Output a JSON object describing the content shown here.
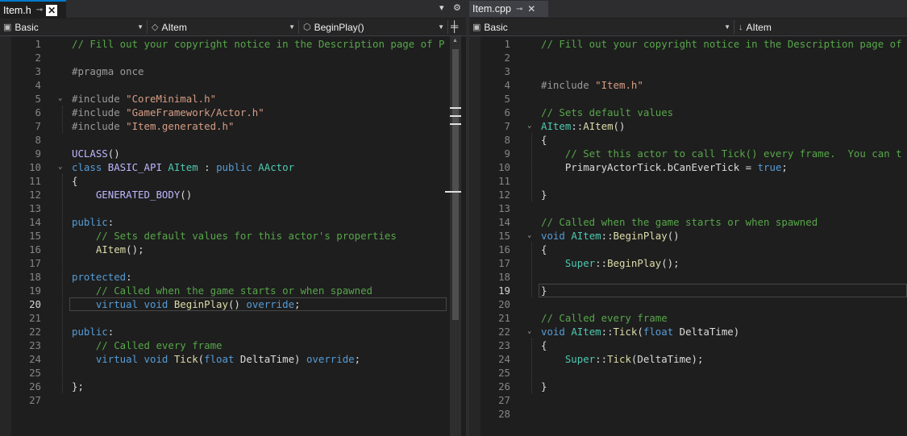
{
  "left": {
    "tab": {
      "name": "Item.h"
    },
    "nav": {
      "project": "Basic",
      "scope": "AItem",
      "member": "BeginPlay()"
    },
    "current_line": 20,
    "lines": [
      {
        "n": "1",
        "t": [
          {
            "c": "t-comment",
            "s": "// Fill out your copyright notice in the Description page of P"
          }
        ]
      },
      {
        "n": "2",
        "t": []
      },
      {
        "n": "3",
        "t": [
          {
            "c": "t-pre",
            "s": "#pragma once"
          }
        ]
      },
      {
        "n": "4",
        "t": []
      },
      {
        "n": "5",
        "fold": true,
        "t": [
          {
            "c": "t-pre",
            "s": "#include "
          },
          {
            "c": "t-str",
            "s": "\"CoreMinimal.h\""
          }
        ]
      },
      {
        "n": "6",
        "t": [
          {
            "c": "t-pre",
            "s": "#include "
          },
          {
            "c": "t-str",
            "s": "\"GameFramework/Actor.h\""
          }
        ]
      },
      {
        "n": "7",
        "t": [
          {
            "c": "t-pre",
            "s": "#include "
          },
          {
            "c": "t-str",
            "s": "\"Item.generated.h\""
          }
        ]
      },
      {
        "n": "8",
        "t": []
      },
      {
        "n": "9",
        "t": [
          {
            "c": "t-macro",
            "s": "UCLASS"
          },
          {
            "c": "t-plain",
            "s": "()"
          }
        ]
      },
      {
        "n": "10",
        "fold": true,
        "t": [
          {
            "c": "t-kw",
            "s": "class "
          },
          {
            "c": "t-macro",
            "s": "BASIC_API "
          },
          {
            "c": "t-type",
            "s": "AItem"
          },
          {
            "c": "t-plain",
            "s": " : "
          },
          {
            "c": "t-kw",
            "s": "public "
          },
          {
            "c": "t-type",
            "s": "AActor"
          }
        ]
      },
      {
        "n": "11",
        "t": [
          {
            "c": "t-plain",
            "s": "{"
          }
        ]
      },
      {
        "n": "12",
        "t": [
          {
            "c": "t-plain",
            "s": "    "
          },
          {
            "c": "t-macro",
            "s": "GENERATED_BODY"
          },
          {
            "c": "t-plain",
            "s": "()"
          }
        ]
      },
      {
        "n": "13",
        "t": []
      },
      {
        "n": "14",
        "t": [
          {
            "c": "t-kw",
            "s": "public"
          },
          {
            "c": "t-plain",
            "s": ":"
          }
        ]
      },
      {
        "n": "15",
        "t": [
          {
            "c": "t-plain",
            "s": "    "
          },
          {
            "c": "t-comment",
            "s": "// Sets default values for this actor's properties"
          }
        ]
      },
      {
        "n": "16",
        "t": [
          {
            "c": "t-plain",
            "s": "    "
          },
          {
            "c": "t-fn",
            "s": "AItem"
          },
          {
            "c": "t-plain",
            "s": "();"
          }
        ]
      },
      {
        "n": "17",
        "t": []
      },
      {
        "n": "18",
        "t": [
          {
            "c": "t-kw",
            "s": "protected"
          },
          {
            "c": "t-plain",
            "s": ":"
          }
        ]
      },
      {
        "n": "19",
        "t": [
          {
            "c": "t-plain",
            "s": "    "
          },
          {
            "c": "t-comment",
            "s": "// Called when the game starts or when spawned"
          }
        ]
      },
      {
        "n": "20",
        "t": [
          {
            "c": "t-plain",
            "s": "    "
          },
          {
            "c": "t-kw",
            "s": "virtual void "
          },
          {
            "c": "t-fn",
            "s": "BeginPlay"
          },
          {
            "c": "t-plain",
            "s": "() "
          },
          {
            "c": "t-kw",
            "s": "override"
          },
          {
            "c": "t-plain",
            "s": ";"
          }
        ]
      },
      {
        "n": "21",
        "t": []
      },
      {
        "n": "22",
        "t": [
          {
            "c": "t-kw",
            "s": "public"
          },
          {
            "c": "t-plain",
            "s": ":"
          }
        ]
      },
      {
        "n": "23",
        "t": [
          {
            "c": "t-plain",
            "s": "    "
          },
          {
            "c": "t-comment",
            "s": "// Called every frame"
          }
        ]
      },
      {
        "n": "24",
        "t": [
          {
            "c": "t-plain",
            "s": "    "
          },
          {
            "c": "t-kw",
            "s": "virtual void "
          },
          {
            "c": "t-fn",
            "s": "Tick"
          },
          {
            "c": "t-plain",
            "s": "("
          },
          {
            "c": "t-kw",
            "s": "float "
          },
          {
            "c": "t-plain",
            "s": "DeltaTime) "
          },
          {
            "c": "t-kw",
            "s": "override"
          },
          {
            "c": "t-plain",
            "s": ";"
          }
        ]
      },
      {
        "n": "25",
        "t": []
      },
      {
        "n": "26",
        "t": [
          {
            "c": "t-plain",
            "s": "};"
          }
        ]
      },
      {
        "n": "27",
        "t": []
      }
    ]
  },
  "right": {
    "tab": {
      "name": "Item.cpp"
    },
    "nav": {
      "project": "Basic",
      "scope": "AItem"
    },
    "current_line": 19,
    "lines": [
      {
        "n": "1",
        "t": [
          {
            "c": "t-comment",
            "s": "// Fill out your copyright notice in the Description page of"
          }
        ]
      },
      {
        "n": "2",
        "t": []
      },
      {
        "n": "3",
        "t": []
      },
      {
        "n": "4",
        "t": [
          {
            "c": "t-pre",
            "s": "#include "
          },
          {
            "c": "t-str",
            "s": "\"Item.h\""
          }
        ]
      },
      {
        "n": "5",
        "t": []
      },
      {
        "n": "6",
        "t": [
          {
            "c": "t-comment",
            "s": "// Sets default values"
          }
        ]
      },
      {
        "n": "7",
        "fold": true,
        "t": [
          {
            "c": "t-type",
            "s": "AItem"
          },
          {
            "c": "t-plain",
            "s": "::"
          },
          {
            "c": "t-fn",
            "s": "AItem"
          },
          {
            "c": "t-plain",
            "s": "()"
          }
        ]
      },
      {
        "n": "8",
        "t": [
          {
            "c": "t-plain",
            "s": "{"
          }
        ]
      },
      {
        "n": "9",
        "t": [
          {
            "c": "t-plain",
            "s": "    "
          },
          {
            "c": "t-comment",
            "s": "// Set this actor to call Tick() every frame.  You can t"
          }
        ]
      },
      {
        "n": "10",
        "t": [
          {
            "c": "t-plain",
            "s": "    PrimaryActorTick.bCanEverTick = "
          },
          {
            "c": "t-kw",
            "s": "true"
          },
          {
            "c": "t-plain",
            "s": ";"
          }
        ]
      },
      {
        "n": "11",
        "t": []
      },
      {
        "n": "12",
        "t": [
          {
            "c": "t-plain",
            "s": "}"
          }
        ]
      },
      {
        "n": "13",
        "t": []
      },
      {
        "n": "14",
        "t": [
          {
            "c": "t-comment",
            "s": "// Called when the game starts or when spawned"
          }
        ]
      },
      {
        "n": "15",
        "fold": true,
        "t": [
          {
            "c": "t-kw",
            "s": "void "
          },
          {
            "c": "t-type",
            "s": "AItem"
          },
          {
            "c": "t-plain",
            "s": "::"
          },
          {
            "c": "t-fn",
            "s": "BeginPlay"
          },
          {
            "c": "t-plain",
            "s": "()"
          }
        ]
      },
      {
        "n": "16",
        "t": [
          {
            "c": "t-plain",
            "s": "{"
          }
        ]
      },
      {
        "n": "17",
        "t": [
          {
            "c": "t-plain",
            "s": "    "
          },
          {
            "c": "t-type",
            "s": "Super"
          },
          {
            "c": "t-plain",
            "s": "::"
          },
          {
            "c": "t-fn",
            "s": "BeginPlay"
          },
          {
            "c": "t-plain",
            "s": "();"
          }
        ]
      },
      {
        "n": "18",
        "t": []
      },
      {
        "n": "19",
        "t": [
          {
            "c": "t-plain",
            "s": "}"
          }
        ]
      },
      {
        "n": "20",
        "t": []
      },
      {
        "n": "21",
        "t": [
          {
            "c": "t-comment",
            "s": "// Called every frame"
          }
        ]
      },
      {
        "n": "22",
        "fold": true,
        "t": [
          {
            "c": "t-kw",
            "s": "void "
          },
          {
            "c": "t-type",
            "s": "AItem"
          },
          {
            "c": "t-plain",
            "s": "::"
          },
          {
            "c": "t-fn",
            "s": "Tick"
          },
          {
            "c": "t-plain",
            "s": "("
          },
          {
            "c": "t-kw",
            "s": "float "
          },
          {
            "c": "t-plain",
            "s": "DeltaTime)"
          }
        ]
      },
      {
        "n": "23",
        "t": [
          {
            "c": "t-plain",
            "s": "{"
          }
        ]
      },
      {
        "n": "24",
        "t": [
          {
            "c": "t-plain",
            "s": "    "
          },
          {
            "c": "t-type",
            "s": "Super"
          },
          {
            "c": "t-plain",
            "s": "::"
          },
          {
            "c": "t-fn",
            "s": "Tick"
          },
          {
            "c": "t-plain",
            "s": "(DeltaTime);"
          }
        ]
      },
      {
        "n": "25",
        "t": []
      },
      {
        "n": "26",
        "t": [
          {
            "c": "t-plain",
            "s": "}"
          }
        ]
      },
      {
        "n": "27",
        "t": []
      },
      {
        "n": "28",
        "t": []
      }
    ]
  }
}
